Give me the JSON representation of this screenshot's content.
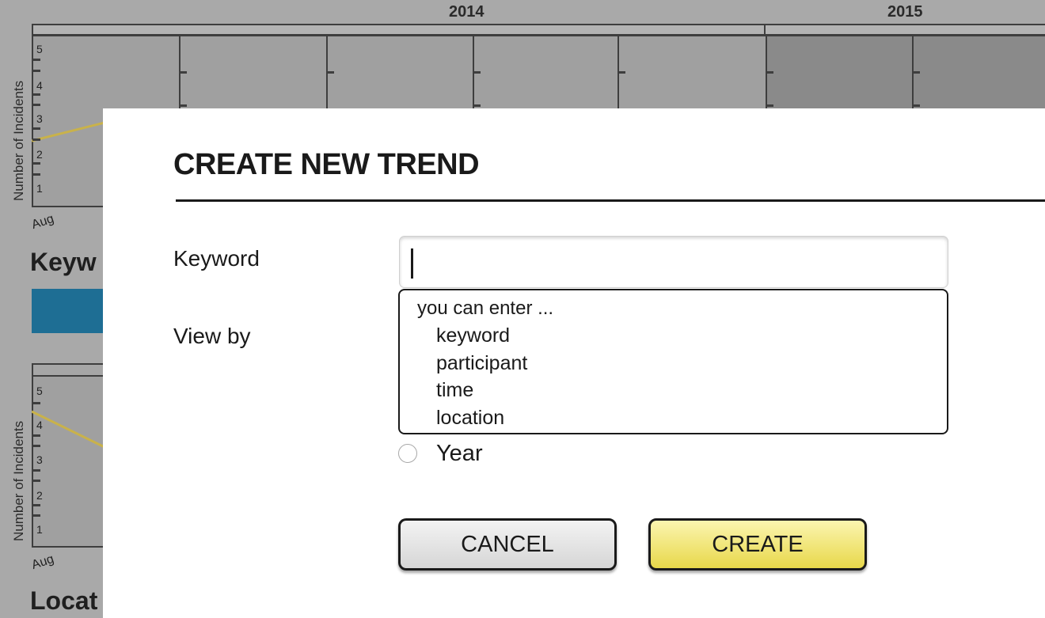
{
  "background": {
    "years": [
      "2014",
      "2015"
    ],
    "y_axis_title": "Number of Incidents",
    "y_ticks": [
      "5",
      "4",
      "3",
      "2",
      "1"
    ],
    "month_label": "Aug",
    "sections": [
      "Keyw",
      "Locat"
    ],
    "colors": {
      "trend_line": "#c9b24a",
      "blue_bar": "#1e6e94"
    }
  },
  "modal": {
    "title": "CREATE NEW TREND",
    "keyword_label": "Keyword",
    "view_by_label": "View by",
    "keyword_value": "",
    "suggestions": {
      "header": "you can enter ...",
      "items": [
        "keyword",
        "participant",
        "time",
        "location"
      ]
    },
    "view_by_option": "Year",
    "cancel_label": "CANCEL",
    "create_label": "CREATE",
    "colors": {
      "create_button": "#e8d84a",
      "cancel_button": "#d6d6d6"
    }
  }
}
